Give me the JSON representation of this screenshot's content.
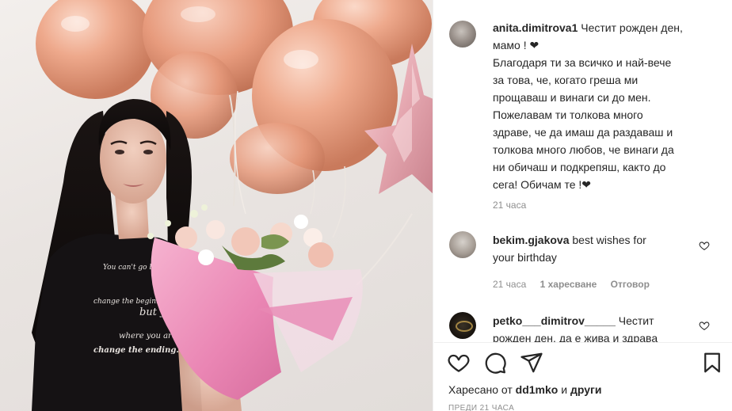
{
  "post": {
    "author": "anita.dimitrova1",
    "caption_lines": [
      "Честит рожден ден,",
      "мамо ! ❤",
      "Благодаря ти за всичко и най-вече",
      "за това, че, когато греша ми",
      "прощаваш и винаги си до мен.",
      "Пожелавам ти толкова много",
      "здраве, че да имаш да раздаваш и",
      "толкова много любов, че винаги да",
      "ни обичаш и подкрепяш, както до",
      "сега! Обичам те !❤"
    ],
    "caption_time": "21 часа"
  },
  "comments": [
    {
      "user": "bekim.gjakova",
      "text_lines": [
        "best wishes for",
        "your birthday"
      ],
      "time": "21 часа",
      "likes": "1 харесване",
      "reply": "Отговор"
    },
    {
      "user": "petko___dimitrov_____",
      "text_lines": [
        "Честит",
        "рожден ден, да е жива и здрава"
      ]
    }
  ],
  "liked_by": {
    "prefix": "Харесано от",
    "user": "dd1mko",
    "conjunction": "и",
    "others": "други"
  },
  "posted_time": "преди 21 часа",
  "shirt_text": [
    "You can't go back",
    "change the beginning,",
    "but you",
    "where you are",
    "change the ending."
  ],
  "icons": {
    "like": "heart-outline-icon",
    "comment": "comment-bubble-icon",
    "share": "paper-plane-icon",
    "save": "bookmark-icon"
  },
  "colors": {
    "text": "#262626",
    "muted": "#8e8e8e",
    "balloon": "#e9a48a"
  }
}
